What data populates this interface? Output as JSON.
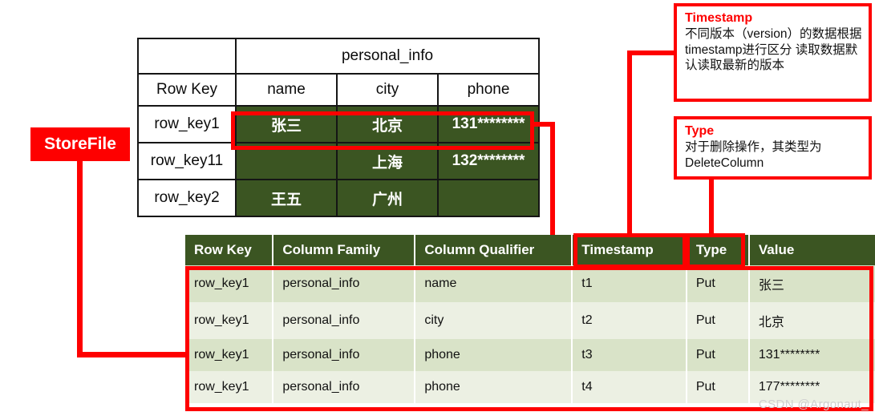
{
  "callout": {
    "storefile_label": "StoreFile"
  },
  "logical_table": {
    "column_family_label": "personal_info",
    "row_key_header": "Row Key",
    "qualifiers": [
      "name",
      "city",
      "phone"
    ],
    "rows": [
      {
        "row_key": "row_key1",
        "name": "张三",
        "city": "北京",
        "phone": "131********"
      },
      {
        "row_key": "row_key11",
        "name": "",
        "city": "上海",
        "phone": "132********"
      },
      {
        "row_key": "row_key2",
        "name": "王五",
        "city": "广州",
        "phone": ""
      }
    ]
  },
  "storefile_table": {
    "headers": [
      "Row Key",
      "Column Family",
      "Column Qualifier",
      "Timestamp",
      "Type",
      "Value"
    ],
    "rows": [
      {
        "row_key": "row_key1",
        "column_family": "personal_info",
        "column_qualifier": "name",
        "timestamp": "t1",
        "type": "Put",
        "value": "张三"
      },
      {
        "row_key": "row_key1",
        "column_family": "personal_info",
        "column_qualifier": "city",
        "timestamp": "t2",
        "type": "Put",
        "value": "北京"
      },
      {
        "row_key": "row_key1",
        "column_family": "personal_info",
        "column_qualifier": "phone",
        "timestamp": "t3",
        "type": "Put",
        "value": "131********"
      },
      {
        "row_key": "row_key1",
        "column_family": "personal_info",
        "column_qualifier": "phone",
        "timestamp": "t4",
        "type": "Put",
        "value": "177********"
      }
    ]
  },
  "notes": {
    "timestamp": {
      "title": "Timestamp",
      "body": "不同版本（version）的数据根据timestamp进行区分 读取数据默认读取最新的版本"
    },
    "type": {
      "title": "Type",
      "body": "对于删除操作，其类型为 DeleteColumn"
    }
  },
  "watermark": "CSDN @Argonaut_",
  "colors": {
    "accent_red": "#fe0000",
    "header_green": "#3b5522",
    "row_green_odd": "#d9e3c8",
    "row_green_even": "#ecf0e3",
    "grid_black": "#151515"
  }
}
